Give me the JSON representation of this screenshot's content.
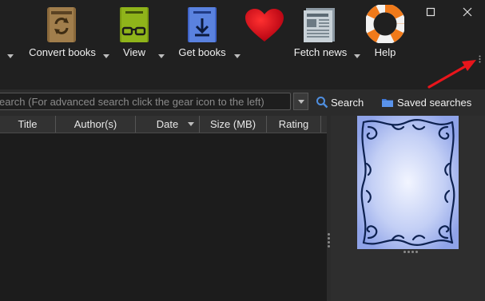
{
  "window": {
    "minimize_icon": "minimize-icon",
    "maximize_icon": "maximize-icon",
    "close_icon": "close-icon"
  },
  "toolbar": {
    "items": [
      {
        "label": "Convert books",
        "icon": "convert-books-icon"
      },
      {
        "label": "View",
        "icon": "view-glasses-icon"
      },
      {
        "label": "Get books",
        "icon": "get-books-icon"
      },
      {
        "label": "",
        "icon": "heart-icon"
      },
      {
        "label": "Fetch news",
        "icon": "newspaper-icon"
      },
      {
        "label": "Help",
        "icon": "lifebuoy-icon"
      }
    ]
  },
  "search": {
    "placeholder": "earch (For advanced search click the gear icon to the left)",
    "search_label": "Search",
    "saved_label": "Saved searches"
  },
  "table": {
    "columns": [
      "Title",
      "Author(s)",
      "Date",
      "Size (MB)",
      "Rating"
    ]
  },
  "colors": {
    "accent_arrow": "#e8151b",
    "cover_blue": "#aabbee",
    "cover_ornament": "#0d2150"
  }
}
